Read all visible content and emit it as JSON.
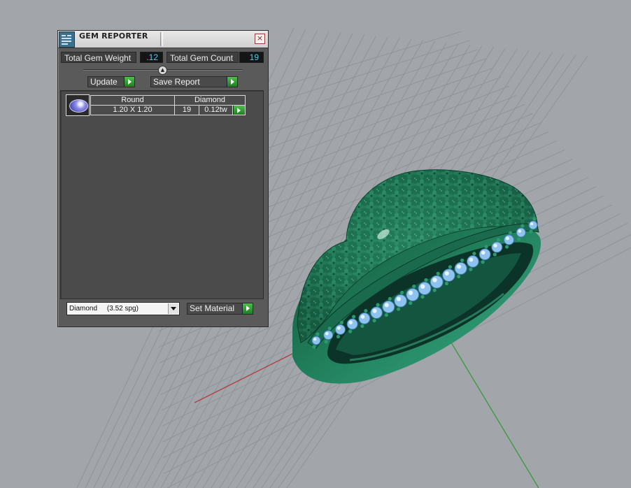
{
  "panel": {
    "title": "GEM REPORTER",
    "close_symbol": "×",
    "total_gem_weight_label": "Total Gem Weight",
    "total_gem_weight_value": ".12",
    "total_gem_count_label": "Total Gem Count",
    "total_gem_count_value": "19",
    "update_label": "Update",
    "save_report_label": "Save Report",
    "gem_rows": [
      {
        "shape": "Round",
        "material": "Diamond",
        "size": "1.20 X 1.20",
        "count": "19",
        "weight": "0.12tw"
      }
    ],
    "material_select_value": "Diamond     (3.52 spg)",
    "set_material_label": "Set Material"
  },
  "icons": [
    "gem-reporter-app-icon",
    "close-icon",
    "slider-knob-icon",
    "go-arrow-icon",
    "gem-thumbnail-icon",
    "dropdown-arrow-icon"
  ],
  "colors": {
    "viewport_bg": "#a2a6ab",
    "grid": "#8e9297",
    "ring_green": "#1f7a57",
    "gem_blue": "#8ec3f0",
    "value_text": "#56c9e6",
    "go_button": "#2e9f30"
  }
}
